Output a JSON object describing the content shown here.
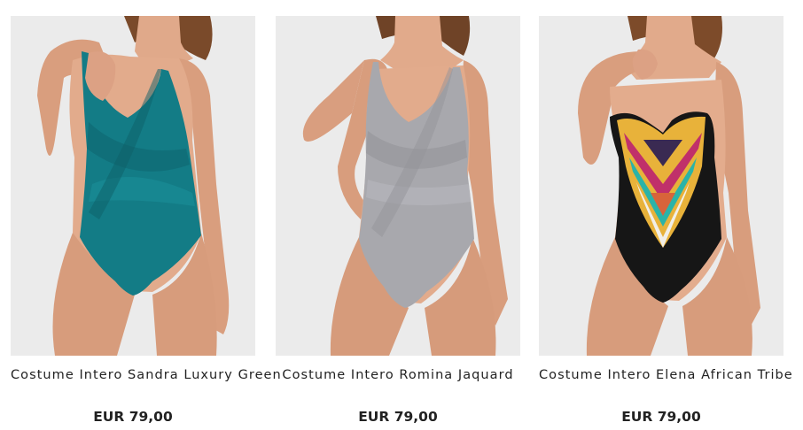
{
  "products": [
    {
      "name": "Costume Intero Sandra Luxury Green",
      "price": "EUR 79,00",
      "swimsuit_color": "#137c86",
      "image": "model wearing a teal wrap one-piece swimsuit"
    },
    {
      "name": "Costume Intero Romina Jaquard",
      "price": "EUR 79,00",
      "swimsuit_color": "#a6a6ab",
      "image": "model wearing a grey jacquard wrap one-piece swimsuit"
    },
    {
      "name": "Costume Intero Elena African Tribe",
      "price": "EUR 79,00",
      "swimsuit_color": "#161616",
      "image": "model wearing a black strapless swimsuit with tribal print"
    }
  ]
}
